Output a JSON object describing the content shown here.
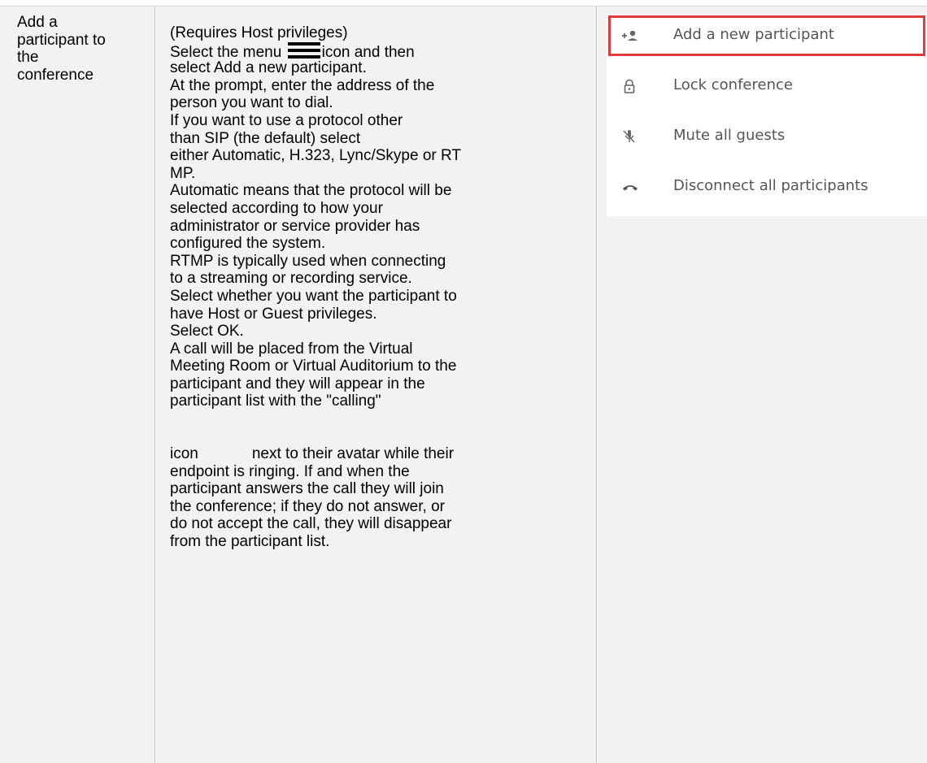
{
  "label": [
    "Add a",
    "participant to",
    "the",
    "conference"
  ],
  "description": {
    "lines_a": [
      "(Requires Host privileges)"
    ],
    "menu_line_before": "Select the menu",
    "menu_line_after": "icon and then",
    "lines_b": [
      "select Add a new participant.",
      "At the prompt, enter the address of the",
      "person you want to dial.",
      "If you want to use a protocol other",
      "than SIP (the default) select",
      "either Automatic, H.323, Lync/Skype or RT",
      "MP.",
      "Automatic means that the protocol will be",
      "selected according to how your",
      "administrator or service provider has",
      "configured the system.",
      "RTMP is typically used when connecting",
      "to a streaming or recording service.",
      "Select whether you want the participant to",
      "have Host or Guest privileges.",
      "Select OK.",
      "A call will be placed from the Virtual",
      "Meeting Room or Virtual Auditorium to the",
      "participant and they will appear in the",
      "participant list with the \"calling\""
    ],
    "icon_line_before": "icon",
    "icon_line_after": "next to their avatar while their",
    "lines_c": [
      "endpoint is ringing. If and when the",
      "participant answers the call they will join",
      "the conference; if they do not answer, or",
      "do not accept the call, they will disappear",
      "from the participant list."
    ]
  },
  "menu": {
    "items": [
      {
        "label": "Add a new participant",
        "icon": "add-participant-icon",
        "highlighted": true
      },
      {
        "label": "Lock conference",
        "icon": "lock-icon",
        "highlighted": false
      },
      {
        "label": "Mute all guests",
        "icon": "mic-off-icon",
        "highlighted": false
      },
      {
        "label": "Disconnect all participants",
        "icon": "phone-hangup-icon",
        "highlighted": false
      }
    ],
    "highlight_color": "#e03a3a"
  }
}
